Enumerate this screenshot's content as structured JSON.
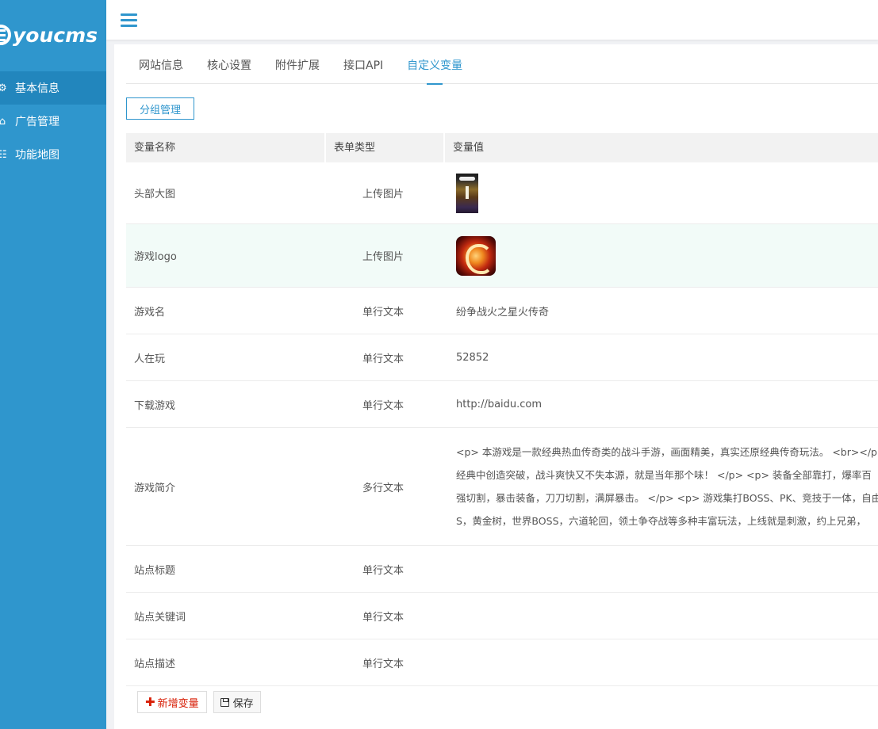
{
  "sidebar": {
    "logo_text": "youcms",
    "items": [
      {
        "label": "基本信息",
        "icon": "gear-icon",
        "glyph": "⚙"
      },
      {
        "label": "广告管理",
        "icon": "home-icon",
        "glyph": "⌂"
      },
      {
        "label": "功能地图",
        "icon": "sitemap-icon",
        "glyph": "☷"
      }
    ]
  },
  "tabs": [
    {
      "label": "网站信息"
    },
    {
      "label": "核心设置"
    },
    {
      "label": "附件扩展"
    },
    {
      "label": "接口API"
    },
    {
      "label": "自定义变量"
    }
  ],
  "active_tab": "自定义变量",
  "group_button": "分组管理",
  "table": {
    "headers": [
      "变量名称",
      "表单类型",
      "变量值"
    ],
    "rows": [
      {
        "name": "头部大图",
        "type": "上传图片",
        "value": ""
      },
      {
        "name": "游戏logo",
        "type": "上传图片",
        "value": ""
      },
      {
        "name": "游戏名",
        "type": "单行文本",
        "value": "纷争战火之星火传奇"
      },
      {
        "name": "人在玩",
        "type": "单行文本",
        "value": "52852"
      },
      {
        "name": "下载游戏",
        "type": "单行文本",
        "value": "http://baidu.com"
      },
      {
        "name": "游戏简介",
        "type": "多行文本",
        "lines": [
          "<p> 本游戏是一款经典热血传奇类的战斗手游，画面精美，真实还原经典传奇玩法。 <br></p>",
          "经典中创造突破，战斗爽快又不失本源，就是当年那个味！ </p> <p> 装备全部靠打，爆率百",
          "强切割，暴击装备，刀刀切割，满屏暴击。 </p> <p> 游戏集打BOSS、PK、竞技于一体，自由",
          "S，黄金树，世界BOSS，六道轮回，领土争夺战等多种丰富玩法，上线就是刺激，约上兄弟，"
        ]
      },
      {
        "name": "站点标题",
        "type": "单行文本",
        "value": ""
      },
      {
        "name": "站点关键词",
        "type": "单行文本",
        "value": ""
      },
      {
        "name": "站点描述",
        "type": "单行文本",
        "value": ""
      }
    ]
  },
  "actions": {
    "add_label": "新增变量",
    "save_label": "保存"
  },
  "colors": {
    "sidebar_bg": "#2f96cd",
    "sidebar_active": "#2286bd",
    "accent": "#2f96cd",
    "add_red": "#d81e06",
    "row_highlight": "#f2fbf8"
  }
}
